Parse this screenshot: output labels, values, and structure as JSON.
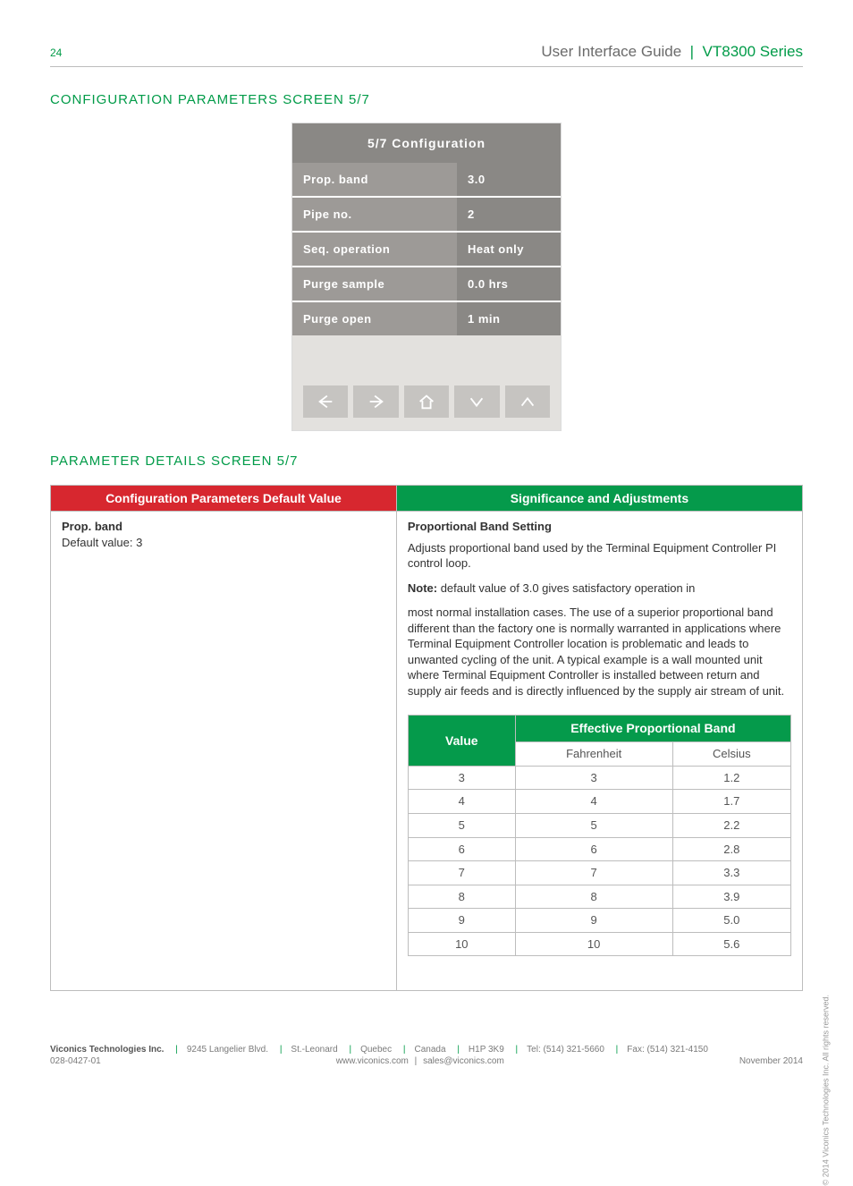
{
  "header": {
    "page_number": "24",
    "doc_title": "User Interface Guide",
    "series": "VT8300 Series"
  },
  "section1": "CONFIGURATION PARAMETERS SCREEN 5/7",
  "device": {
    "title": "5/7 Configuration",
    "rows": [
      {
        "label": "Prop. band",
        "value": "3.0"
      },
      {
        "label": "Pipe no.",
        "value": "2"
      },
      {
        "label": "Seq. operation",
        "value": "Heat only"
      },
      {
        "label": "Purge sample",
        "value": "0.0 hrs"
      },
      {
        "label": "Purge open",
        "value": "1 min"
      }
    ]
  },
  "section2": "PARAMETER DETAILS SCREEN 5/7",
  "paramTable": {
    "headers": {
      "left": "Configuration Parameters Default Value",
      "right": "Significance and Adjustments"
    },
    "param_name": "Prop. band",
    "default_label": "Default value: 3",
    "sig_title": "Proportional Band Setting",
    "sig_p1": "Adjusts proportional band used by the Terminal Equipment Controller PI control loop.",
    "sig_note_label": "Note:",
    "sig_note_text": " default value of 3.0 gives satisfactory operation in",
    "sig_p2": "most normal installation cases. The use of a superior proportional band different than the factory one is normally warranted in applications where Terminal Equipment Controller location is problematic and leads to unwanted cycling of the unit. A typical example is a wall mounted unit where Terminal Equipment Controller is installed between return and supply air feeds and is directly influenced by the supply air stream of unit."
  },
  "innerTable": {
    "headers": {
      "value": "Value",
      "epb": "Effective Proportional Band"
    },
    "sub": {
      "f": "Fahrenheit",
      "c": "Celsius"
    },
    "rows": [
      {
        "v": "3",
        "f": "3",
        "c": "1.2"
      },
      {
        "v": "4",
        "f": "4",
        "c": "1.7"
      },
      {
        "v": "5",
        "f": "5",
        "c": "2.2"
      },
      {
        "v": "6",
        "f": "6",
        "c": "2.8"
      },
      {
        "v": "7",
        "f": "7",
        "c": "3.3"
      },
      {
        "v": "8",
        "f": "8",
        "c": "3.9"
      },
      {
        "v": "9",
        "f": "9",
        "c": "5.0"
      },
      {
        "v": "10",
        "f": "10",
        "c": "5.6"
      }
    ]
  },
  "footer": {
    "company": "Viconics Technologies Inc.",
    "addr": "9245 Langelier Blvd.",
    "city": "St.-Leonard",
    "prov": "Quebec",
    "country": "Canada",
    "post": "H1P 3K9",
    "tel": "Tel: (514) 321-5660",
    "fax": "Fax: (514) 321-4150",
    "docnum": "028-0427-01",
    "web": "www.viconics.com",
    "email": "sales@viconics.com",
    "date": "November 2014",
    "copyright": "© 2014 Viconics Technologies Inc. All rights reserved."
  }
}
